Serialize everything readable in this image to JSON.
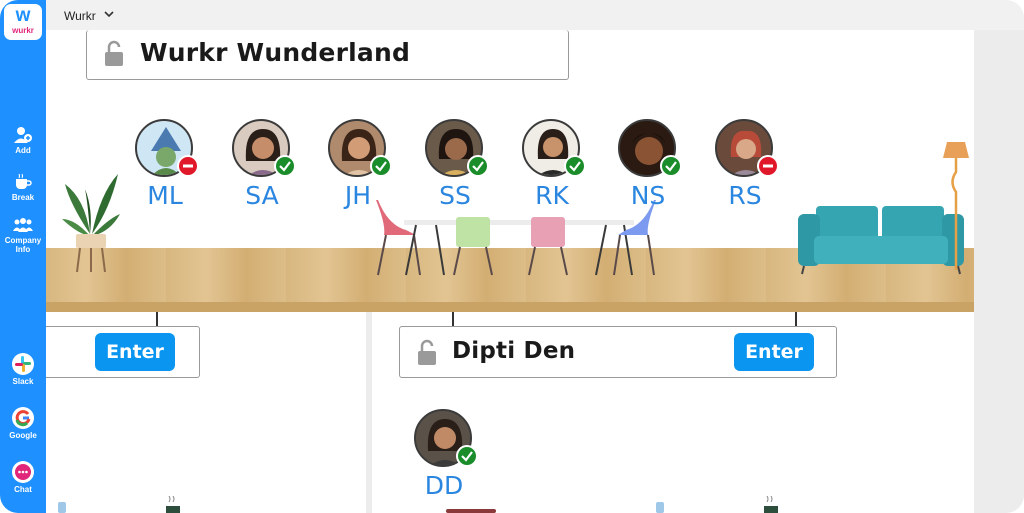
{
  "app": {
    "logo_letter": "w",
    "logo_text": "wurkr"
  },
  "sidebar": {
    "top_items": [
      {
        "label": "Add",
        "icon": "add-user-icon"
      },
      {
        "label": "Break",
        "icon": "coffee-icon"
      },
      {
        "label": "Company Info",
        "icon": "company-icon"
      }
    ],
    "apps": [
      {
        "label": "Slack",
        "icon": "slack-icon"
      },
      {
        "label": "Google",
        "icon": "google-icon"
      },
      {
        "label": "Chat",
        "icon": "chat-icon"
      }
    ]
  },
  "topbar": {
    "workspace": "Wurkr"
  },
  "main_room": {
    "title": "Wurkr Wunderland",
    "members": [
      {
        "initials": "ML",
        "status": "busy",
        "color": "#6aa0c8"
      },
      {
        "initials": "SA",
        "status": "ok",
        "color": "#4b3b33"
      },
      {
        "initials": "JH",
        "status": "ok",
        "color": "#8c5a3c"
      },
      {
        "initials": "SS",
        "status": "ok",
        "color": "#5c4a3a"
      },
      {
        "initials": "RK",
        "status": "ok",
        "color": "#b88a6a"
      },
      {
        "initials": "NS",
        "status": "ok",
        "color": "#7a4a30"
      },
      {
        "initials": "RS",
        "status": "busy",
        "color": "#a07a66"
      }
    ]
  },
  "rooms": [
    {
      "title": "",
      "enter_label": "Enter"
    },
    {
      "title": "Dipti Den",
      "enter_label": "Enter",
      "members": [
        {
          "initials": "DD",
          "status": "ok",
          "color": "#5e4838"
        }
      ]
    }
  ],
  "colors": {
    "accent": "#1e90ff",
    "enter": "#0a95f0",
    "ok": "#1a8d2a",
    "busy": "#e0182a",
    "initials": "#2b86e0"
  }
}
